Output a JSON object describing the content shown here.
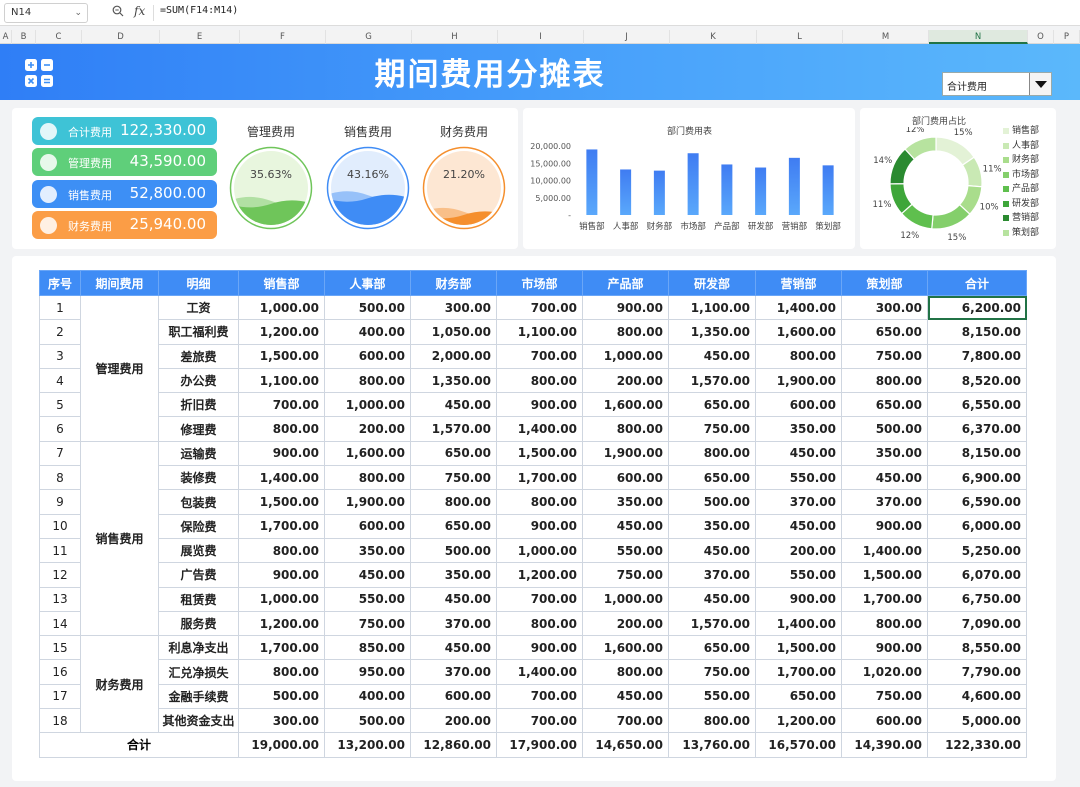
{
  "formula_bar": {
    "cell_ref": "N14",
    "fx": "fx",
    "formula": "=SUM(F14:M14)"
  },
  "columns": [
    "A",
    "B",
    "C",
    "D",
    "E",
    "F",
    "G",
    "H",
    "I",
    "J",
    "K",
    "L",
    "M",
    "N",
    "O",
    "P"
  ],
  "selected_column": "N",
  "title": "期间费用分摊表",
  "selector": {
    "value": "合计费用"
  },
  "kpis": [
    {
      "label": "合计费用",
      "value": "122,330.00",
      "color": "#3ec3d6"
    },
    {
      "label": "管理费用",
      "value": "43,590.00",
      "color": "#5fcf7a"
    },
    {
      "label": "销售费用",
      "value": "52,800.00",
      "color": "#3d8ff5"
    },
    {
      "label": "财务费用",
      "value": "25,940.00",
      "color": "#fb9d46"
    }
  ],
  "gauges": [
    {
      "title": "管理费用",
      "pct": "35.63%",
      "level": 0.3563,
      "color": "#6fc55a",
      "bg": "#e8f6de"
    },
    {
      "title": "销售费用",
      "pct": "43.16%",
      "level": 0.4316,
      "color": "#3f8cf5",
      "bg": "#e1edfd"
    },
    {
      "title": "财务费用",
      "pct": "21.20%",
      "level": 0.212,
      "color": "#f58f2d",
      "bg": "#fde7d3"
    }
  ],
  "chart_data": [
    {
      "type": "bar",
      "title": "部门费用表",
      "categories": [
        "销售部",
        "人事部",
        "财务部",
        "市场部",
        "产品部",
        "研发部",
        "营销部",
        "策划部"
      ],
      "values": [
        19000,
        13200,
        12860,
        17900,
        14650,
        13760,
        16570,
        14390
      ],
      "yticks": [
        "20,000.00",
        "15,000.00",
        "10,000.00",
        "5,000.00",
        "-"
      ],
      "ylim": [
        0,
        20000
      ]
    },
    {
      "type": "pie",
      "title": "部门费用占比",
      "categories": [
        "销售部",
        "人事部",
        "财务部",
        "市场部",
        "产品部",
        "研发部",
        "营销部",
        "策划部"
      ],
      "values": [
        19000,
        13200,
        12860,
        17900,
        14650,
        13760,
        16570,
        14390
      ],
      "labels": [
        "15%",
        "11%",
        "10%",
        "15%",
        "12%",
        "11%",
        "14%",
        "12%"
      ],
      "colors": [
        "#e3f2d6",
        "#c9e9b4",
        "#a9dd8c",
        "#84cf6b",
        "#5fbf4e",
        "#3ea63a",
        "#2a8a30",
        "#b7e39f"
      ]
    }
  ],
  "table": {
    "headers": [
      "序号",
      "期间费用",
      "明细",
      "销售部",
      "人事部",
      "财务部",
      "市场部",
      "产品部",
      "研发部",
      "营销部",
      "策划部",
      "合计"
    ],
    "groups": [
      {
        "name": "管理费用",
        "rows": [
          [
            "1",
            "工资",
            "1,000.00",
            "500.00",
            "300.00",
            "700.00",
            "900.00",
            "1,100.00",
            "1,400.00",
            "300.00",
            "6,200.00"
          ],
          [
            "2",
            "职工福利费",
            "1,200.00",
            "400.00",
            "1,050.00",
            "1,100.00",
            "800.00",
            "1,350.00",
            "1,600.00",
            "650.00",
            "8,150.00"
          ],
          [
            "3",
            "差旅费",
            "1,500.00",
            "600.00",
            "2,000.00",
            "700.00",
            "1,000.00",
            "450.00",
            "800.00",
            "750.00",
            "7,800.00"
          ],
          [
            "4",
            "办公费",
            "1,100.00",
            "800.00",
            "1,350.00",
            "800.00",
            "200.00",
            "1,570.00",
            "1,900.00",
            "800.00",
            "8,520.00"
          ],
          [
            "5",
            "折旧费",
            "700.00",
            "1,000.00",
            "450.00",
            "900.00",
            "1,600.00",
            "650.00",
            "600.00",
            "650.00",
            "6,550.00"
          ],
          [
            "6",
            "修理费",
            "800.00",
            "200.00",
            "1,570.00",
            "1,400.00",
            "800.00",
            "750.00",
            "350.00",
            "500.00",
            "6,370.00"
          ]
        ]
      },
      {
        "name": "销售费用",
        "rows": [
          [
            "7",
            "运输费",
            "900.00",
            "1,600.00",
            "650.00",
            "1,500.00",
            "1,900.00",
            "800.00",
            "450.00",
            "350.00",
            "8,150.00"
          ],
          [
            "8",
            "装修费",
            "1,400.00",
            "800.00",
            "750.00",
            "1,700.00",
            "600.00",
            "650.00",
            "550.00",
            "450.00",
            "6,900.00"
          ],
          [
            "9",
            "包装费",
            "1,500.00",
            "1,900.00",
            "800.00",
            "800.00",
            "350.00",
            "500.00",
            "370.00",
            "370.00",
            "6,590.00"
          ],
          [
            "10",
            "保险费",
            "1,700.00",
            "600.00",
            "650.00",
            "900.00",
            "450.00",
            "350.00",
            "450.00",
            "900.00",
            "6,000.00"
          ],
          [
            "11",
            "展览费",
            "800.00",
            "350.00",
            "500.00",
            "1,000.00",
            "550.00",
            "450.00",
            "200.00",
            "1,400.00",
            "5,250.00"
          ],
          [
            "12",
            "广告费",
            "900.00",
            "450.00",
            "350.00",
            "1,200.00",
            "750.00",
            "370.00",
            "550.00",
            "1,500.00",
            "6,070.00"
          ],
          [
            "13",
            "租赁费",
            "1,000.00",
            "550.00",
            "450.00",
            "700.00",
            "1,000.00",
            "450.00",
            "900.00",
            "1,700.00",
            "6,750.00"
          ],
          [
            "14",
            "服务费",
            "1,200.00",
            "750.00",
            "370.00",
            "800.00",
            "200.00",
            "1,570.00",
            "1,400.00",
            "800.00",
            "7,090.00"
          ]
        ]
      },
      {
        "name": "财务费用",
        "rows": [
          [
            "15",
            "利息净支出",
            "1,700.00",
            "850.00",
            "450.00",
            "900.00",
            "1,600.00",
            "650.00",
            "1,500.00",
            "900.00",
            "8,550.00"
          ],
          [
            "16",
            "汇兑净损失",
            "800.00",
            "950.00",
            "370.00",
            "1,400.00",
            "800.00",
            "750.00",
            "1,700.00",
            "1,020.00",
            "7,790.00"
          ],
          [
            "17",
            "金融手续费",
            "500.00",
            "400.00",
            "600.00",
            "700.00",
            "450.00",
            "550.00",
            "650.00",
            "750.00",
            "4,600.00"
          ],
          [
            "18",
            "其他资金支出",
            "300.00",
            "500.00",
            "200.00",
            "700.00",
            "700.00",
            "800.00",
            "1,200.00",
            "600.00",
            "5,000.00"
          ]
        ]
      }
    ],
    "total": {
      "label": "合计",
      "values": [
        "19,000.00",
        "13,200.00",
        "12,860.00",
        "17,900.00",
        "14,650.00",
        "13,760.00",
        "16,570.00",
        "14,390.00",
        "122,330.00"
      ]
    }
  }
}
